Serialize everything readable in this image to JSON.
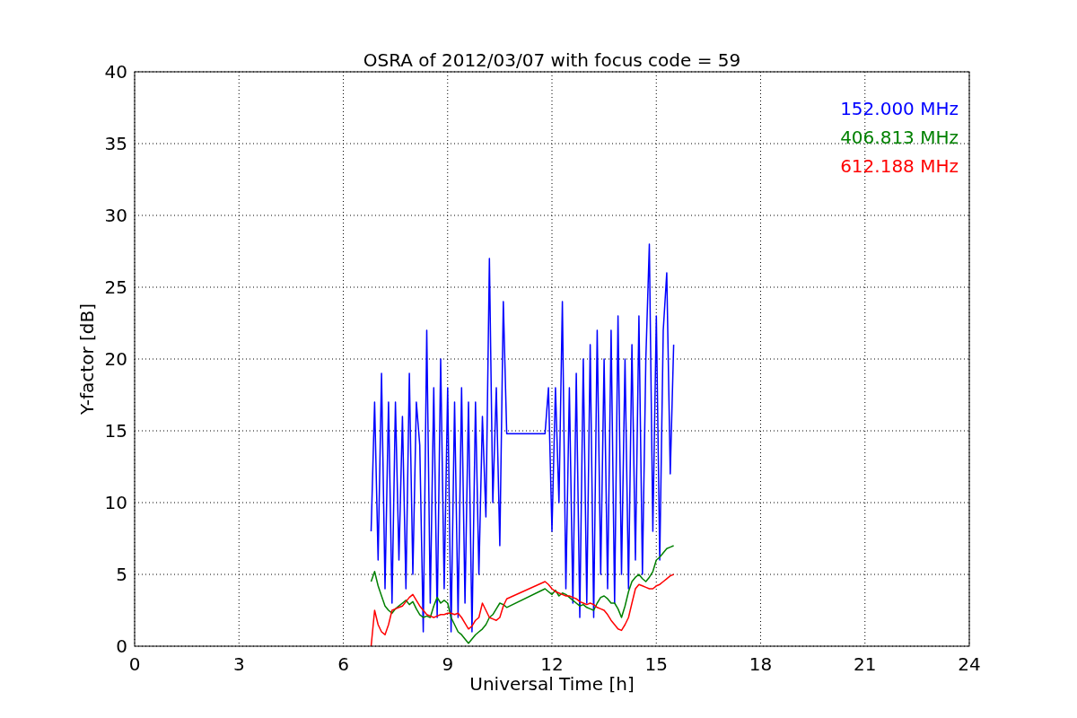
{
  "chart_data": {
    "type": "line",
    "title": "OSRA of 2012/03/07 with focus code = 59",
    "xlabel": "Universal Time [h]",
    "ylabel": "Y-factor [dB]",
    "grid": true,
    "xlim": [
      0,
      24
    ],
    "ylim": [
      0,
      40
    ],
    "xticks": [
      0,
      3,
      6,
      9,
      12,
      15,
      18,
      21,
      24
    ],
    "yticks": [
      0,
      5,
      10,
      15,
      20,
      25,
      30,
      35,
      40
    ],
    "x": [
      6.8,
      6.9,
      7.0,
      7.1,
      7.2,
      7.3,
      7.4,
      7.5,
      7.6,
      7.7,
      7.8,
      7.9,
      8.0,
      8.1,
      8.2,
      8.3,
      8.4,
      8.5,
      8.6,
      8.7,
      8.8,
      8.9,
      9.0,
      9.1,
      9.2,
      9.3,
      9.4,
      9.5,
      9.6,
      9.7,
      9.8,
      9.9,
      10.0,
      10.1,
      10.2,
      10.3,
      10.4,
      10.5,
      10.6,
      10.7,
      11.8,
      11.9,
      12.0,
      12.1,
      12.2,
      12.3,
      12.4,
      12.5,
      12.6,
      12.7,
      12.8,
      12.9,
      13.0,
      13.1,
      13.2,
      13.3,
      13.4,
      13.5,
      13.6,
      13.7,
      13.8,
      13.9,
      14.0,
      14.1,
      14.2,
      14.3,
      14.4,
      14.5,
      14.6,
      14.7,
      14.8,
      14.9,
      15.0,
      15.1,
      15.2,
      15.3,
      15.4,
      15.5
    ],
    "series": [
      {
        "name": "152.000 MHz",
        "color": "#0000ff",
        "values": [
          8,
          17,
          6,
          19,
          4,
          17,
          3,
          17,
          6,
          16,
          4,
          19,
          5,
          17,
          14,
          1,
          22,
          3,
          18,
          2,
          20,
          4,
          18,
          1,
          17,
          2,
          18,
          3,
          17,
          1,
          17,
          5,
          16,
          9,
          27,
          10,
          18,
          7,
          24,
          14.8,
          14.8,
          18,
          8,
          18,
          10,
          24,
          4,
          18,
          3,
          19,
          2,
          20,
          3,
          21,
          2,
          22,
          5,
          20,
          4,
          22,
          3,
          23,
          5,
          20,
          4,
          21,
          6,
          23,
          5,
          20,
          28,
          8,
          23,
          6,
          22,
          26,
          12,
          21
        ]
      },
      {
        "name": "406.813 MHz",
        "color": "#008000",
        "values": [
          4.5,
          5.2,
          4.2,
          3.5,
          2.8,
          2.5,
          2.3,
          2.6,
          2.8,
          3.0,
          3.2,
          2.9,
          3.1,
          2.6,
          2.2,
          2.0,
          2.1,
          2.0,
          2.8,
          3.4,
          3.0,
          3.2,
          3.0,
          2.0,
          1.5,
          1.0,
          0.8,
          0.5,
          0.2,
          0.5,
          0.8,
          1.0,
          1.2,
          1.5,
          2.0,
          2.2,
          2.6,
          3.0,
          2.9,
          2.7,
          4.0,
          3.8,
          3.6,
          3.9,
          3.5,
          3.7,
          3.6,
          3.4,
          3.2,
          3.0,
          2.8,
          2.9,
          2.7,
          2.6,
          2.5,
          3.0,
          3.4,
          3.5,
          3.3,
          3.0,
          3.0,
          2.6,
          2.0,
          2.8,
          3.8,
          4.5,
          4.8,
          5.0,
          4.7,
          4.5,
          4.8,
          5.2,
          6.0,
          6.2,
          6.5,
          6.8,
          6.9,
          7.0
        ]
      },
      {
        "name": "612.188 MHz",
        "color": "#ff0000",
        "values": [
          0,
          2.5,
          1.5,
          1.0,
          0.8,
          1.5,
          2.5,
          2.6,
          2.7,
          2.8,
          3.1,
          3.4,
          3.6,
          3.2,
          2.8,
          2.5,
          2.2,
          2.1,
          2.0,
          2.1,
          2.2,
          2.2,
          2.3,
          2.3,
          2.2,
          2.3,
          2.0,
          1.6,
          1.2,
          1.4,
          1.8,
          2.0,
          3.0,
          2.5,
          2.0,
          1.9,
          1.8,
          2.0,
          2.8,
          3.3,
          4.5,
          4.3,
          4.0,
          3.8,
          3.7,
          3.6,
          3.5,
          3.5,
          3.4,
          3.3,
          3.1,
          3.0,
          2.9,
          3.0,
          2.9,
          2.7,
          2.6,
          2.5,
          2.2,
          1.8,
          1.5,
          1.2,
          1.1,
          1.5,
          2.0,
          3.0,
          4.0,
          4.3,
          4.2,
          4.1,
          4.0,
          4.0,
          4.2,
          4.3,
          4.5,
          4.7,
          4.9,
          5.0
        ]
      }
    ]
  }
}
